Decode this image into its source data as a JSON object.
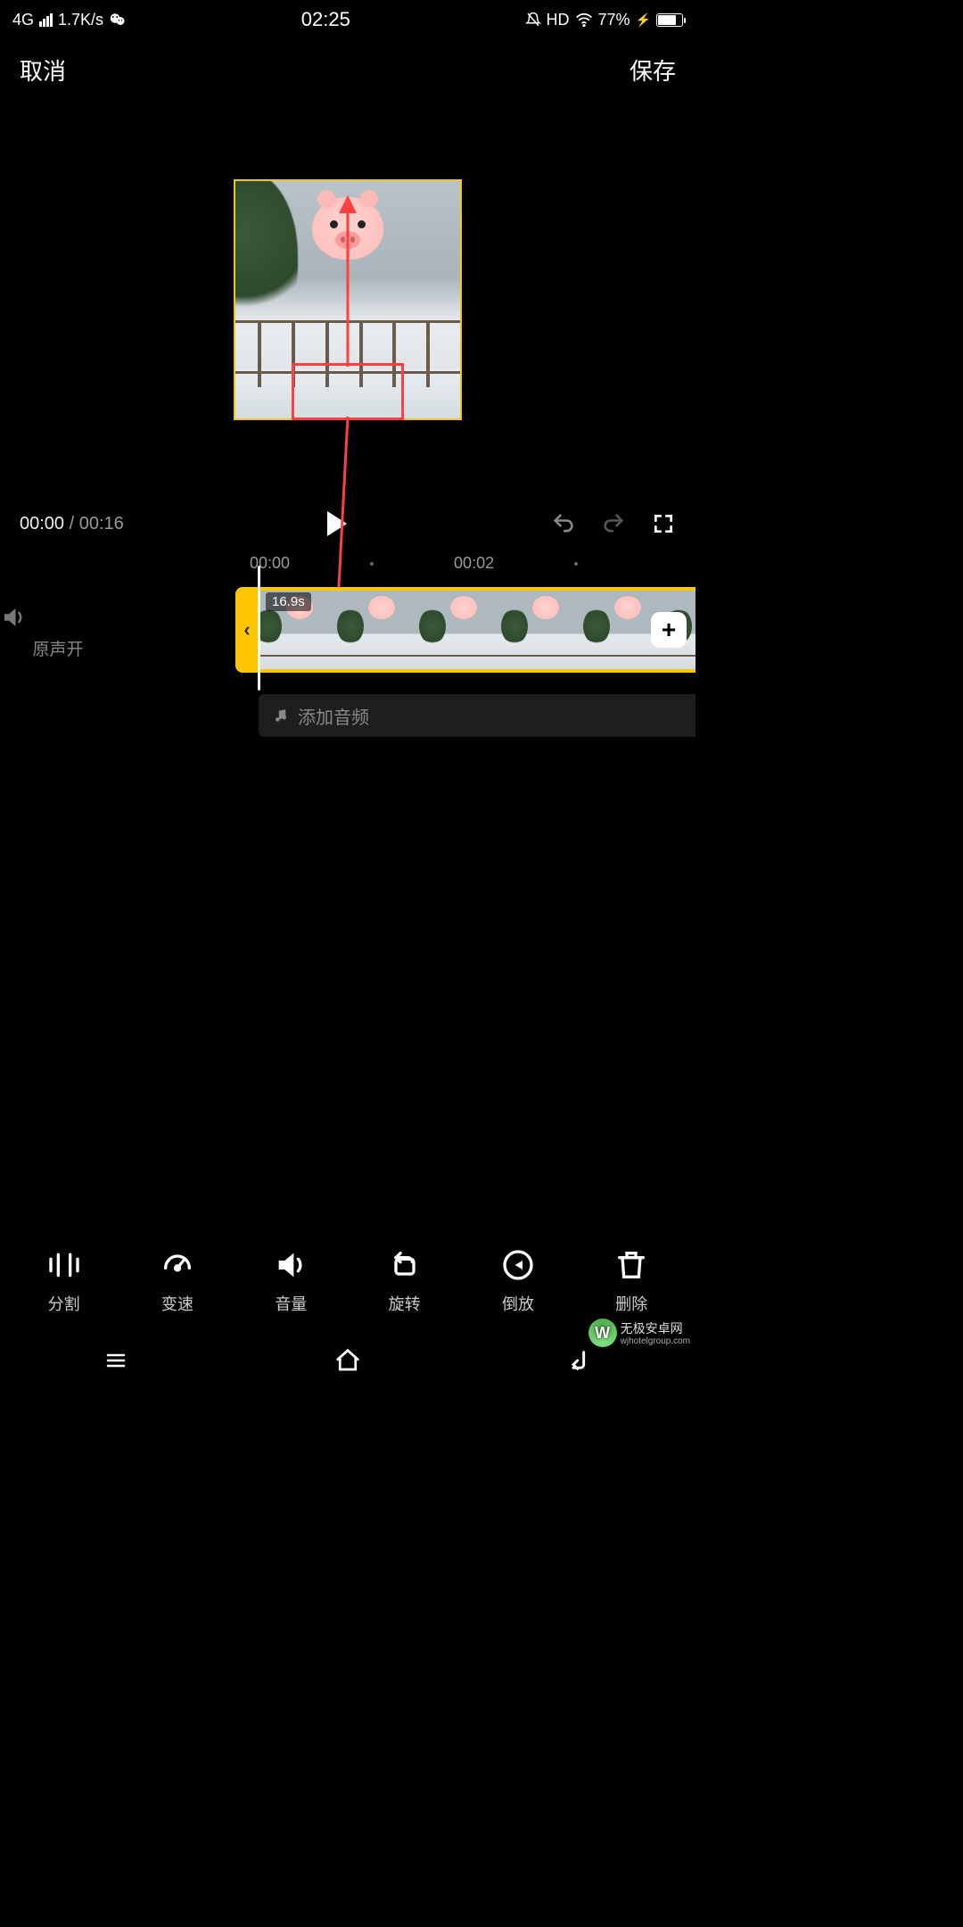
{
  "status": {
    "network": "4G",
    "speed": "1.7K/s",
    "time": "02:25",
    "hd": "HD",
    "battery_pct": "77%"
  },
  "topbar": {
    "cancel": "取消",
    "save": "保存"
  },
  "transport": {
    "current": "00:00",
    "total": "00:16"
  },
  "ruler": {
    "t0": "00:00",
    "t1": "00:02"
  },
  "timeline": {
    "sound_label": "原声开",
    "clip_duration": "16.9s",
    "add_audio": "添加音频"
  },
  "tools": {
    "split": "分割",
    "speed": "变速",
    "volume": "音量",
    "rotate": "旋转",
    "reverse": "倒放",
    "delete": "删除"
  },
  "watermark": {
    "brand": "无极安卓网",
    "url": "wjhotelgroup.com"
  }
}
